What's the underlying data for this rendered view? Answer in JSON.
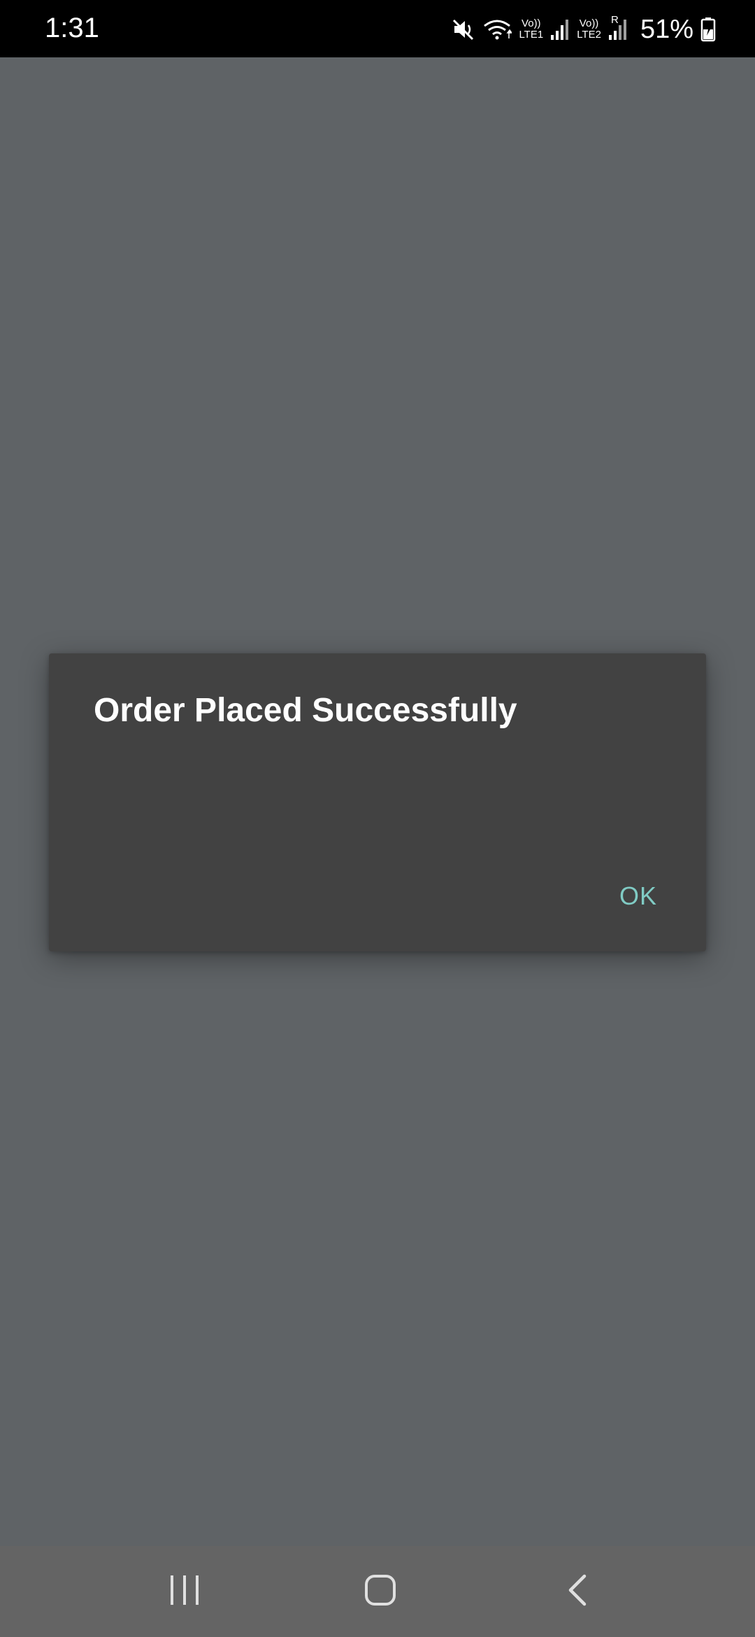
{
  "status_bar": {
    "time": "1:31",
    "battery_percent": "51%",
    "sim1": {
      "top": "Vo))",
      "bottom": "LTE1"
    },
    "sim2": {
      "top": "Vo))",
      "bottom": "LTE2",
      "roaming": "R"
    },
    "icons": [
      "mute-icon",
      "wifi-icon",
      "signal-icon",
      "signal-icon",
      "battery-charging-icon"
    ]
  },
  "dialog": {
    "title": "Order Placed Successfully",
    "ok_label": "OK"
  },
  "nav_bar": {
    "icons": [
      "recent-apps-icon",
      "home-icon",
      "back-icon"
    ]
  },
  "colors": {
    "background": "#5f6366",
    "dialog": "#424242",
    "accent": "#80cbc4",
    "status_bar": "#000000",
    "nav_bar": "#646464"
  }
}
